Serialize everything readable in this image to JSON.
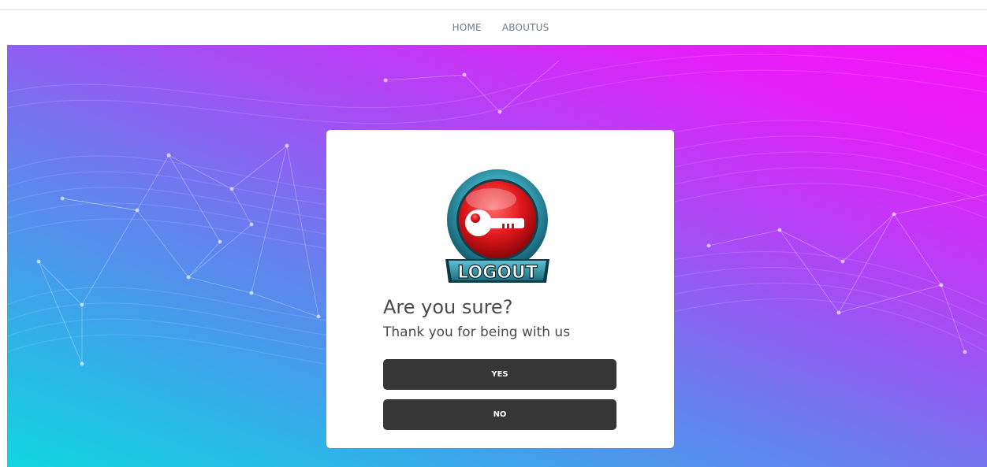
{
  "nav": {
    "items": [
      {
        "label": "HOME"
      },
      {
        "label": "ABOUTUS"
      }
    ]
  },
  "dialog": {
    "badge_text": "LOGOUT",
    "title": "Are you sure?",
    "subtitle": "Thank you for being with us",
    "yes_label": "YES",
    "no_label": "NO"
  },
  "colors": {
    "gradient_start": "#0fd6e0",
    "gradient_mid": "#6a7cef",
    "gradient_end": "#f812f8",
    "button_bg": "#363636",
    "badge_red": "#e0181e",
    "badge_ring": "#2b8fa3"
  }
}
